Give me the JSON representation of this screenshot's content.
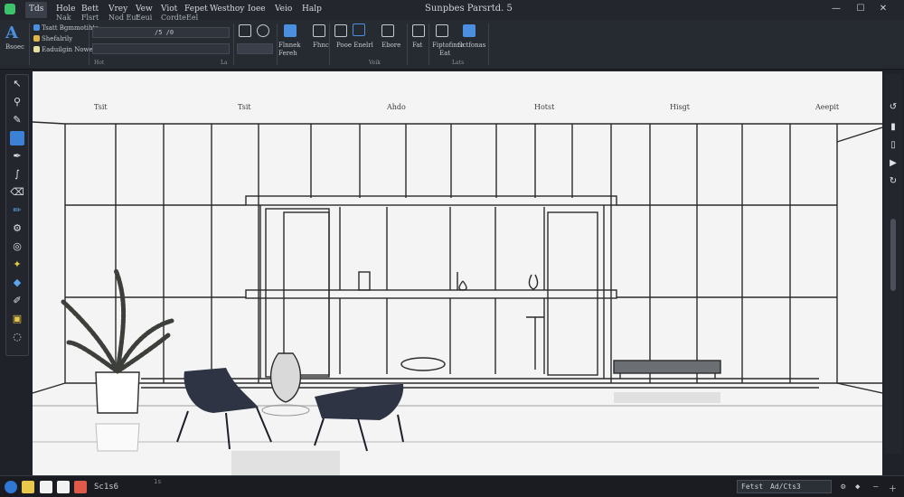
{
  "window": {
    "doc_title": "Sunpbes Parsrtd. 5",
    "menus": [
      "Tds",
      "Hole",
      "Bett",
      "Vrey",
      "Vew",
      "Viot",
      "Fepet",
      "Westhoy",
      "Ioee",
      "Veio",
      "Halp"
    ],
    "submenus": [
      "Nak",
      "Flsrt",
      "Nod Eut",
      "Eeui",
      "Cordte",
      "Eel"
    ],
    "controls": {
      "minimize": "—",
      "maximize": "☐",
      "close": "✕"
    }
  },
  "ribbon": {
    "big_tool_label": "Bsoec",
    "layer_rows": [
      "Tsatt Bgmmotihts",
      "Shefalrily",
      "Eaduilgin Nowei"
    ],
    "field_top": "/5 /0",
    "field_bottom": "",
    "group_labels": [
      "Hot",
      "La"
    ],
    "labels": [
      "Flnnek",
      "Fereh",
      "Fhnc",
      "Pooe Enelrl",
      "Ebore",
      "Veik",
      "Fat",
      "Fiptofinre",
      "Eat",
      "Gctfonas",
      "Lats"
    ]
  },
  "canvas": {
    "labels": [
      "Tsit",
      "Tsit",
      "Ahdo",
      "Hotst",
      "Hisgt",
      "Aeepit"
    ],
    "colors": {
      "background": "#f4f4f4",
      "line": "#2b2b2b",
      "chair": "#2e3444",
      "plant": "#3c3f3a"
    }
  },
  "status": {
    "tray_text": "Sc1s6",
    "zoom_text": "",
    "tiny_label": "1s",
    "coord_label": "Fetst",
    "coord_value": "Ad/Cts3"
  },
  "tools": {
    "left_icons": [
      "pointer-icon",
      "zoom-icon",
      "pen-icon",
      "select-icon",
      "dropper-icon",
      "brush-icon",
      "eraser-icon",
      "pencil-icon",
      "gear-icon",
      "magnet-icon",
      "paint-icon",
      "fill-icon",
      "brush-small-icon",
      "note-icon",
      "lasso-icon"
    ],
    "right_icons": [
      "undo-icon",
      "doc-icon",
      "page-icon",
      "play-icon",
      "redo-icon"
    ]
  }
}
